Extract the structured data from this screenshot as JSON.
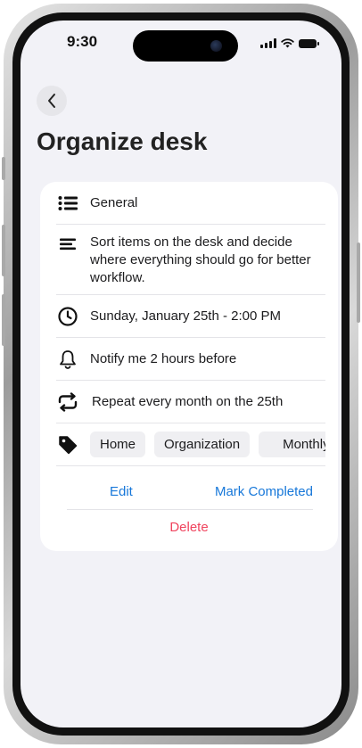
{
  "status_bar": {
    "time": "9:30"
  },
  "header": {
    "title": "Organize desk"
  },
  "details": {
    "category": "General",
    "description": "Sort items on the desk and decide where everything should go for better workflow.",
    "due": "Sunday, January 25th - 2:00 PM",
    "reminder": "Notify me 2 hours before",
    "repeat": "Repeat every month on the 25th",
    "tags": [
      "Home",
      "Organization",
      "Monthly"
    ]
  },
  "actions": {
    "edit": "Edit",
    "mark_completed": "Mark Completed",
    "delete": "Delete"
  },
  "colors": {
    "accent": "#1677d9",
    "destructive": "#f0445e",
    "background": "#f2f2f7"
  },
  "icons": [
    "back-chevron-icon",
    "list-icon",
    "description-icon",
    "clock-icon",
    "bell-icon",
    "repeat-icon",
    "tag-icon",
    "wifi-icon",
    "signal-icon",
    "battery-icon"
  ]
}
